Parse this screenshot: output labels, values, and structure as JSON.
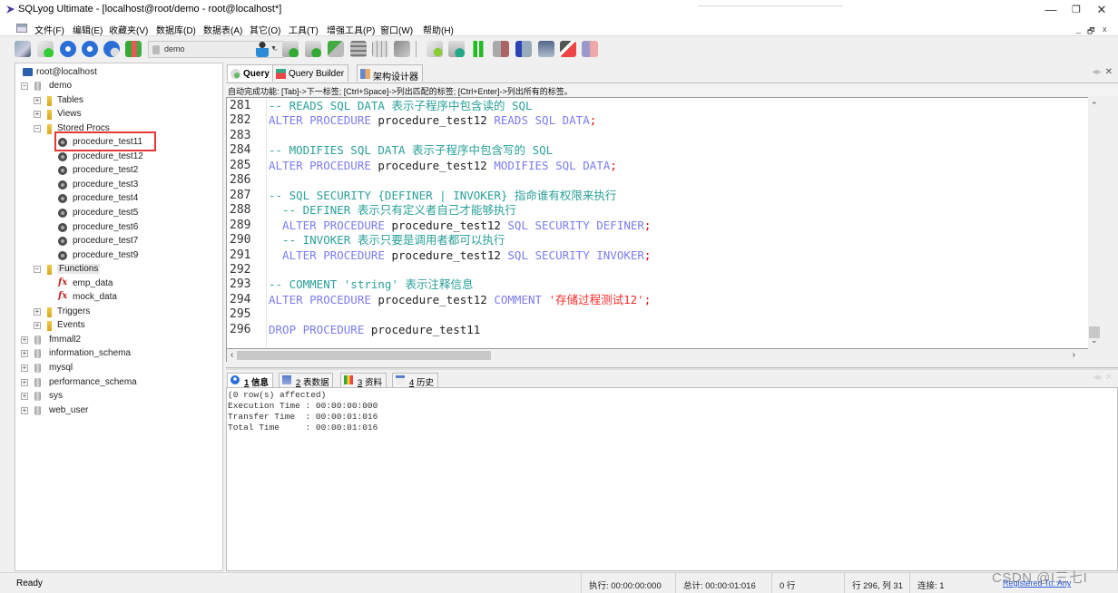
{
  "window": {
    "title": "SQLyog Ultimate - [localhost@root/demo - root@localhost*]",
    "minimize": "—",
    "maximize": "❐",
    "close": "✕",
    "mdi_controls": [
      "_",
      "🗗",
      "x"
    ]
  },
  "menu": {
    "items": [
      "文件(F)",
      "编辑(E)",
      "收藏夹(V)",
      "数据库(D)",
      "数据表(A)",
      "其它(O)",
      "工具(T)",
      "增强工具(P)",
      "窗口(W)",
      "帮助(H)"
    ]
  },
  "toolbar": {
    "database_select": "demo",
    "icons_left": [
      "new-connection-icon",
      "new-query-icon",
      "execute-query-icon",
      "execute-all-icon",
      "execute-edit-icon",
      "schema-sync-icon"
    ],
    "icons_right": [
      "user-manager-icon",
      "import-icon",
      "export-icon",
      "backup-icon",
      "table-data-icon",
      "table-grid-icon",
      "copy-table-icon",
      "sql-formatter-icon",
      "data-sync-icon",
      "schema-compare-icon",
      "import-external-icon",
      "sql-scheduler-icon",
      "visual-report-icon",
      "table-designer-icon",
      "schema-designer-icon"
    ]
  },
  "tree": {
    "root": "root@localhost",
    "nodes": [
      {
        "label": "demo",
        "type": "db",
        "expanded": true,
        "level": 1
      },
      {
        "label": "Tables",
        "type": "folder",
        "expanded": false,
        "level": 2
      },
      {
        "label": "Views",
        "type": "folder",
        "expanded": false,
        "level": 2
      },
      {
        "label": "Stored Procs",
        "type": "folder",
        "expanded": true,
        "level": 2
      },
      {
        "label": "procedure_test11",
        "type": "proc",
        "level": 3,
        "highlighted": true
      },
      {
        "label": "procedure_test12",
        "type": "proc",
        "level": 3
      },
      {
        "label": "procedure_test2",
        "type": "proc",
        "level": 3
      },
      {
        "label": "procedure_test3",
        "type": "proc",
        "level": 3
      },
      {
        "label": "procedure_test4",
        "type": "proc",
        "level": 3
      },
      {
        "label": "procedure_test5",
        "type": "proc",
        "level": 3
      },
      {
        "label": "procedure_test6",
        "type": "proc",
        "level": 3
      },
      {
        "label": "procedure_test7",
        "type": "proc",
        "level": 3
      },
      {
        "label": "procedure_test9",
        "type": "proc",
        "level": 3
      },
      {
        "label": "Functions",
        "type": "folder",
        "expanded": true,
        "level": 2
      },
      {
        "label": "emp_data",
        "type": "func",
        "level": 3
      },
      {
        "label": "mock_data",
        "type": "func",
        "level": 3
      },
      {
        "label": "Triggers",
        "type": "folder",
        "expanded": false,
        "level": 2
      },
      {
        "label": "Events",
        "type": "folder",
        "expanded": false,
        "level": 2
      },
      {
        "label": "fmmall2",
        "type": "db",
        "expanded": false,
        "level": 1
      },
      {
        "label": "information_schema",
        "type": "db",
        "expanded": false,
        "level": 1
      },
      {
        "label": "mysql",
        "type": "db",
        "expanded": false,
        "level": 1
      },
      {
        "label": "performance_schema",
        "type": "db",
        "expanded": false,
        "level": 1
      },
      {
        "label": "sys",
        "type": "db",
        "expanded": false,
        "level": 1
      },
      {
        "label": "web_user",
        "type": "db",
        "expanded": false,
        "level": 1
      }
    ]
  },
  "editor_tabs": [
    {
      "label": "Query",
      "active": true
    },
    {
      "label": "Query Builder",
      "active": false
    },
    {
      "label": "架构设计器",
      "active": false
    }
  ],
  "hint": "自动完成功能: [Tab]->下一标签; [Ctrl+Space]->列出匹配的标签; [Ctrl+Enter]->列出所有的标签。",
  "code_lines": [
    {
      "n": "281",
      "tokens": [
        {
          "t": "-- READS SQL DATA 表示子程序中包含读的 SQL",
          "c": "cm"
        }
      ]
    },
    {
      "n": "282",
      "tokens": [
        {
          "t": "ALTER PROCEDURE ",
          "c": "kw"
        },
        {
          "t": "procedure_test12 ",
          "c": "id"
        },
        {
          "t": "READS SQL DATA",
          "c": "kw"
        },
        {
          "t": ";",
          "c": "punc"
        }
      ]
    },
    {
      "n": "283",
      "tokens": []
    },
    {
      "n": "284",
      "tokens": [
        {
          "t": "-- MODIFIES SQL DATA 表示子程序中包含写的 SQL",
          "c": "cm"
        }
      ]
    },
    {
      "n": "285",
      "tokens": [
        {
          "t": "ALTER PROCEDURE ",
          "c": "kw"
        },
        {
          "t": "procedure_test12 ",
          "c": "id"
        },
        {
          "t": "MODIFIES SQL DATA",
          "c": "kw"
        },
        {
          "t": ";",
          "c": "punc"
        }
      ]
    },
    {
      "n": "286",
      "tokens": []
    },
    {
      "n": "287",
      "tokens": [
        {
          "t": "-- SQL SECURITY {DEFINER | INVOKER} 指命谁有权限来执行",
          "c": "cm"
        }
      ]
    },
    {
      "n": "288",
      "tokens": [
        {
          "t": "  -- DEFINER 表示只有定义者自己才能够执行",
          "c": "cm"
        }
      ]
    },
    {
      "n": "289",
      "tokens": [
        {
          "t": "  ALTER PROCEDURE ",
          "c": "kw"
        },
        {
          "t": "procedure_test12 ",
          "c": "id"
        },
        {
          "t": "SQL SECURITY DEFINER",
          "c": "kw"
        },
        {
          "t": ";",
          "c": "punc"
        }
      ]
    },
    {
      "n": "290",
      "tokens": [
        {
          "t": "  -- INVOKER 表示只要是调用者都可以执行",
          "c": "cm"
        }
      ]
    },
    {
      "n": "291",
      "tokens": [
        {
          "t": "  ALTER PROCEDURE ",
          "c": "kw"
        },
        {
          "t": "procedure_test12 ",
          "c": "id"
        },
        {
          "t": "SQL SECURITY INVOKER",
          "c": "kw"
        },
        {
          "t": ";",
          "c": "punc"
        }
      ]
    },
    {
      "n": "292",
      "tokens": []
    },
    {
      "n": "293",
      "tokens": [
        {
          "t": "-- COMMENT 'string' 表示注释信息",
          "c": "cm"
        }
      ]
    },
    {
      "n": "294",
      "tokens": [
        {
          "t": "ALTER PROCEDURE ",
          "c": "kw"
        },
        {
          "t": "procedure_test12 ",
          "c": "id"
        },
        {
          "t": "COMMENT ",
          "c": "kw"
        },
        {
          "t": "'存储过程测试12'",
          "c": "str"
        },
        {
          "t": ";",
          "c": "punc"
        }
      ]
    },
    {
      "n": "295",
      "tokens": []
    },
    {
      "n": "296",
      "tokens": [
        {
          "t": "DROP PROCEDURE ",
          "c": "kw"
        },
        {
          "t": "procedure_test11",
          "c": "id"
        }
      ]
    }
  ],
  "result_tabs": [
    {
      "num": "1",
      "label": "信息",
      "active": true
    },
    {
      "num": "2",
      "label": "表数据",
      "active": false
    },
    {
      "num": "3",
      "label": "资料",
      "active": false
    },
    {
      "num": "4",
      "label": "历史",
      "active": false
    }
  ],
  "messages": [
    "(0 row(s) affected)",
    "Execution Time : 00:00:00:000",
    "Transfer Time  : 00:00:01:016",
    "Total Time     : 00:00:01:016"
  ],
  "status": {
    "ready": "Ready",
    "exec": "执行: 00:00:00:000",
    "total": "总计: 00:00:01:016",
    "rows": "0 行",
    "position": "行 296, 列 31",
    "connections": "连接: 1",
    "registered": "Registered To: Any"
  },
  "watermark": "CSDN @I三七I",
  "colors": {
    "keyword": "#7c7cf0",
    "comment": "#2aa198",
    "string": "#ff2a2a",
    "highlight_box": "#e53935"
  }
}
